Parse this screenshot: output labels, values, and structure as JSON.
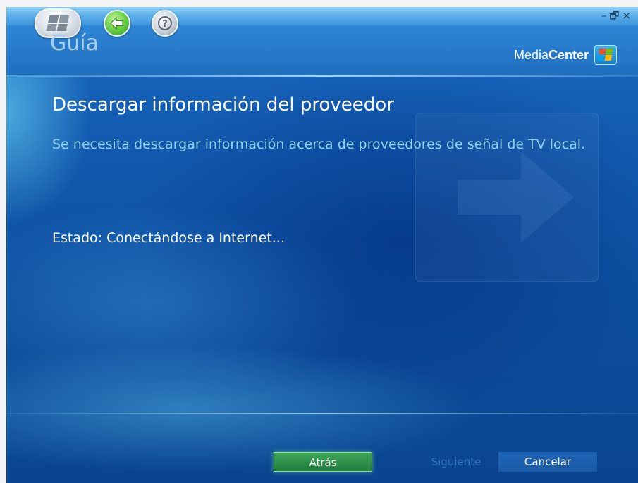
{
  "app": {
    "page_title": "Guía",
    "brand": {
      "prefix": "Media",
      "bold": "Center"
    }
  },
  "titlebar": {
    "minimize": "–",
    "restore": "🗗",
    "close": "×"
  },
  "content": {
    "heading": "Descargar información del proveedor",
    "description": "Se necesita descargar información acerca de proveedores de señal de TV local.",
    "status": "Estado: Conectándose a Internet..."
  },
  "buttons": {
    "back": "Atrás",
    "next": "Siguiente",
    "cancel": "Cancelar"
  },
  "icons": {
    "start": "windows-flag-icon",
    "back": "back-arrow-icon",
    "help": "help-icon"
  },
  "colors": {
    "accent": "#1b6ec6",
    "back_button": "#2a8d48",
    "description_text": "#8fd2f4"
  }
}
